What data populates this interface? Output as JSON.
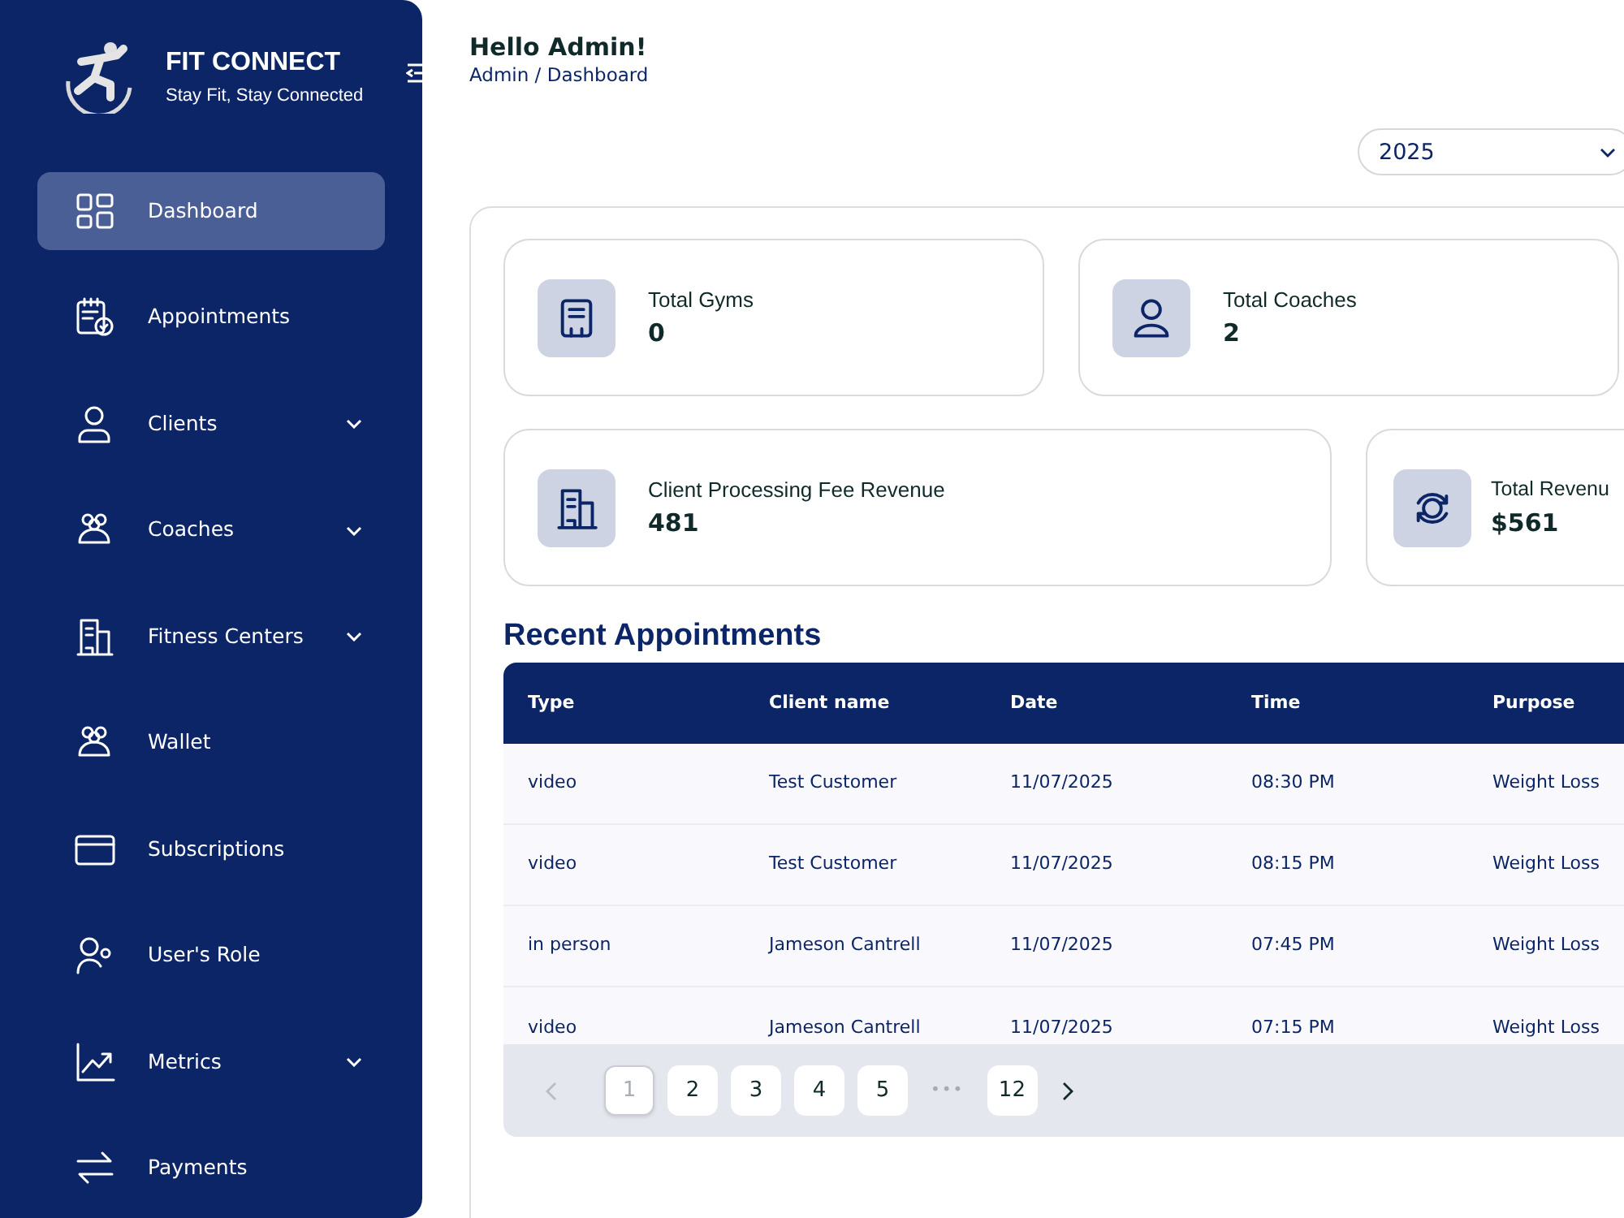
{
  "brand": {
    "name": "FIT CONNECT",
    "tagline": "Stay Fit, Stay Connected"
  },
  "sidebar": {
    "items": [
      {
        "label": "Dashboard",
        "selected": true,
        "submenu": false
      },
      {
        "label": "Appointments",
        "selected": false,
        "submenu": false
      },
      {
        "label": "Clients",
        "selected": false,
        "submenu": true
      },
      {
        "label": "Coaches",
        "selected": false,
        "submenu": true
      },
      {
        "label": "Fitness Centers",
        "selected": false,
        "submenu": true
      },
      {
        "label": "Wallet",
        "selected": false,
        "submenu": false
      },
      {
        "label": "Subscriptions",
        "selected": false,
        "submenu": false
      },
      {
        "label": "User's Role",
        "selected": false,
        "submenu": false
      },
      {
        "label": "Metrics",
        "selected": false,
        "submenu": true
      },
      {
        "label": "Payments",
        "selected": false,
        "submenu": false
      }
    ]
  },
  "header": {
    "greeting": "Hello Admin!",
    "breadcrumb": "Admin / Dashboard"
  },
  "year_select": {
    "value": "2025"
  },
  "stats": [
    {
      "label": "Total Gyms",
      "value": "0"
    },
    {
      "label": "Total Coaches",
      "value": "2"
    },
    {
      "label": "Client Processing Fee Revenue",
      "value": "481"
    },
    {
      "label": "Total Revenu",
      "value": "$561"
    }
  ],
  "recent_appointments": {
    "title": "Recent Appointments",
    "columns": [
      "Type",
      "Client name",
      "Date",
      "Time",
      "Purpose"
    ],
    "rows": [
      [
        "video",
        "Test Customer",
        "11/07/2025",
        "08:30 PM",
        "Weight Loss"
      ],
      [
        "video",
        "Test Customer",
        "11/07/2025",
        "08:15 PM",
        "Weight Loss"
      ],
      [
        "in person",
        "Jameson Cantrell",
        "11/07/2025",
        "07:45 PM",
        "Weight Loss"
      ],
      [
        "video",
        "Jameson Cantrell",
        "11/07/2025",
        "07:15 PM",
        "Weight Loss"
      ]
    ]
  },
  "pagination": {
    "prev_disabled": true,
    "next_disabled": false,
    "pages": [
      {
        "kind": "page",
        "label": "1",
        "selected": true
      },
      {
        "kind": "page",
        "label": "2",
        "selected": false
      },
      {
        "kind": "page",
        "label": "3",
        "selected": false
      },
      {
        "kind": "page",
        "label": "4",
        "selected": false
      },
      {
        "kind": "page",
        "label": "5",
        "selected": false
      },
      {
        "kind": "ellipsis",
        "label": "•••"
      },
      {
        "kind": "page",
        "label": "12",
        "selected": false
      }
    ]
  }
}
